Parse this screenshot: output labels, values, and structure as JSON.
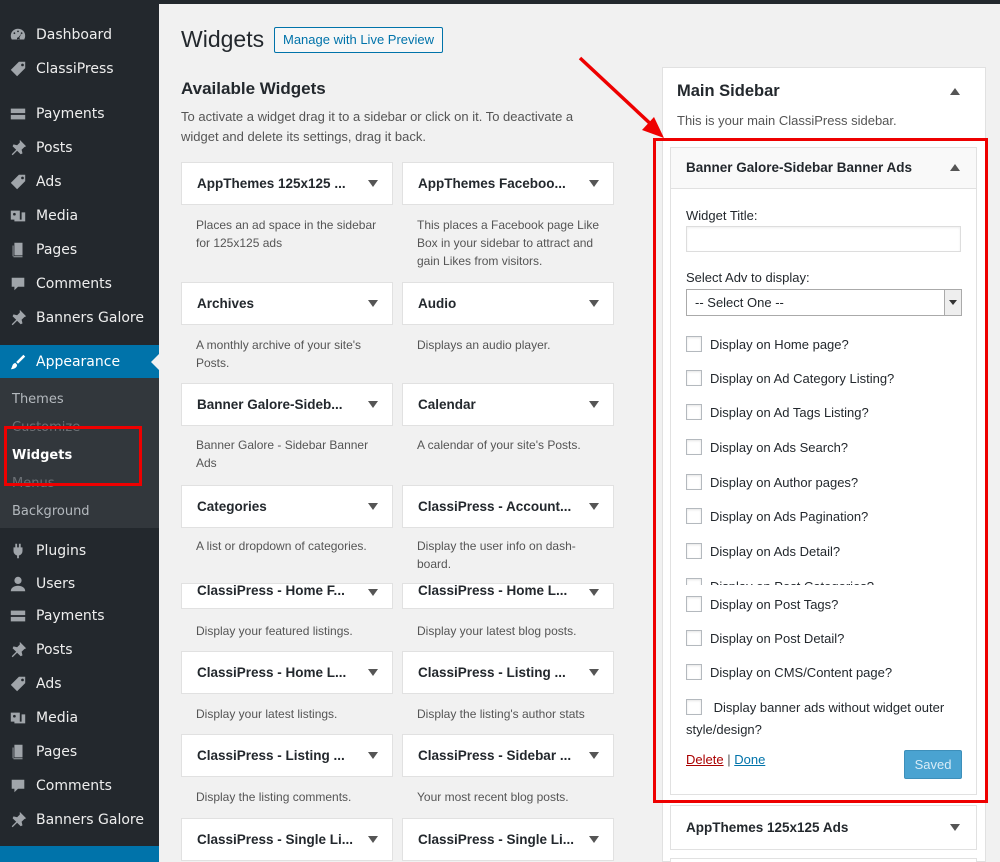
{
  "sidebar": {
    "items": [
      {
        "label": "Dashboard",
        "icon": "dashboard-icon"
      },
      {
        "label": "ClassiPress",
        "icon": "tag-icon"
      },
      {
        "label": "Payments",
        "icon": "payments-icon"
      },
      {
        "label": "Posts",
        "icon": "pin-icon"
      },
      {
        "label": "Ads",
        "icon": "tag-icon"
      },
      {
        "label": "Media",
        "icon": "media-icon"
      },
      {
        "label": "Pages",
        "icon": "pages-icon"
      },
      {
        "label": "Comments",
        "icon": "comments-icon"
      },
      {
        "label": "Banners Galore",
        "icon": "pin-icon"
      },
      {
        "label": "Appearance",
        "icon": "paintbrush-icon"
      },
      {
        "label": "Plugins",
        "icon": "plugins-icon"
      },
      {
        "label": "Users",
        "icon": "users-icon"
      },
      {
        "label": "Payments",
        "icon": "payments-icon"
      },
      {
        "label": "Posts",
        "icon": "pin-icon"
      },
      {
        "label": "Ads",
        "icon": "tag-icon"
      },
      {
        "label": "Media",
        "icon": "media-icon"
      },
      {
        "label": "Pages",
        "icon": "pages-icon"
      },
      {
        "label": "Comments",
        "icon": "comments-icon"
      },
      {
        "label": "Banners Galore",
        "icon": "pin-icon"
      }
    ],
    "submenu": [
      "Themes",
      "Customize",
      "Widgets",
      "Menus",
      "Background"
    ]
  },
  "header": {
    "title": "Widgets",
    "live_preview": "Manage with Live Preview"
  },
  "available": {
    "title": "Available Widgets",
    "description": "To activate a widget drag it to a sidebar or click on it. To deactivate a widget and delete its settings, drag it back.",
    "widgets": [
      {
        "name": "AppThemes 125x125 ...",
        "desc": "Places an ad space in the sidebar for 125x125 ads"
      },
      {
        "name": "AppThemes Faceboo...",
        "desc": "This places a Facebook page Like Box in your sidebar to attract and gain Likes from visitors."
      },
      {
        "name": "Archives",
        "desc": "A monthly archive of your site's Posts."
      },
      {
        "name": "Audio",
        "desc": "Displays an audio player."
      },
      {
        "name": "Banner Galore-Sideb...",
        "desc": "Banner Galore - Sidebar Banner Ads"
      },
      {
        "name": "Calendar",
        "desc": "A calendar of your site's Posts."
      },
      {
        "name": "Categories",
        "desc": "A list or dropdown of categories."
      },
      {
        "name": "ClassiPress - Account...",
        "desc": "Display the user info on dash-board."
      },
      {
        "name": "ClassiPress - Home F...",
        "desc": "Display your featured listings."
      },
      {
        "name": "ClassiPress - Home L...",
        "desc": "Display your latest blog posts."
      },
      {
        "name": "ClassiPress - Home L...",
        "desc": "Display your latest listings."
      },
      {
        "name": "ClassiPress - Listing ...",
        "desc": "Display the listing's author stats"
      },
      {
        "name": "ClassiPress - Listing ...",
        "desc": "Display the listing comments."
      },
      {
        "name": "ClassiPress - Sidebar ...",
        "desc": "Your most recent blog posts."
      },
      {
        "name": "ClassiPress - Single Li...",
        "desc": ""
      },
      {
        "name": "ClassiPress - Single Li...",
        "desc": ""
      }
    ]
  },
  "main_sidebar": {
    "title": "Main Sidebar",
    "description": "This is your main ClassiPress sidebar.",
    "open_widget": {
      "title": "Banner Galore-Sidebar Banner Ads",
      "widget_title_label": "Widget Title:",
      "widget_title_value": "",
      "select_label": "Select Adv to display:",
      "select_value": "-- Select One --",
      "checkboxes": [
        "Display on Home page?",
        "Display on Ad Category Listing?",
        "Display on Ad Tags Listing?",
        "Display on Ads Search?",
        "Display on Author pages?",
        "Display on Ads Pagination?",
        "Display on Ads Detail?",
        "Display on Post Categories?",
        "Display on Post Tags?",
        "Display on Post Detail?",
        "Display on CMS/Content page?",
        "Display banner ads without widget outer style/design?"
      ],
      "delete": "Delete",
      "separator": "|",
      "done": "Done",
      "saved": "Saved"
    },
    "next_widget": "AppThemes 125x125 Ads"
  },
  "colors": {
    "admin_bar": "#23282d",
    "accent": "#0073aa",
    "annotation": "#e00000"
  }
}
